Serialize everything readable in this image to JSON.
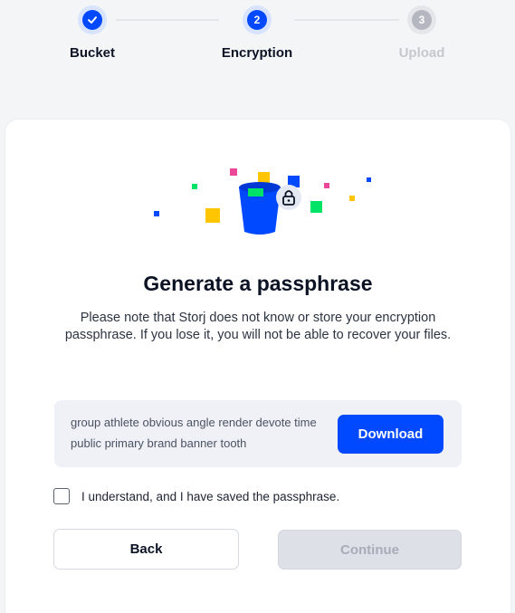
{
  "stepper": {
    "steps": [
      {
        "label": "Bucket",
        "state": "done",
        "icon": "checkmark-icon"
      },
      {
        "label": "Encryption",
        "state": "active",
        "number": "2"
      },
      {
        "label": "Upload",
        "state": "pending",
        "number": "3"
      }
    ]
  },
  "card": {
    "illustration_icon": "bucket-with-lock-icon",
    "title": "Generate a passphrase",
    "description": "Please note that Storj does not know or store your encryption passphrase. If you lose it, you will not be able to recover your files.",
    "passphrase": "group athlete obvious angle render devote time public primary brand banner tooth",
    "download_label": "Download",
    "checkbox_label": "I understand, and I have saved the passphrase.",
    "checkbox_checked": false,
    "back_label": "Back",
    "continue_label": "Continue",
    "continue_disabled": true
  },
  "colors": {
    "accent": "#0149ff",
    "disabled_bg": "#dde0e6",
    "pending_step": "#c6c8cd"
  }
}
